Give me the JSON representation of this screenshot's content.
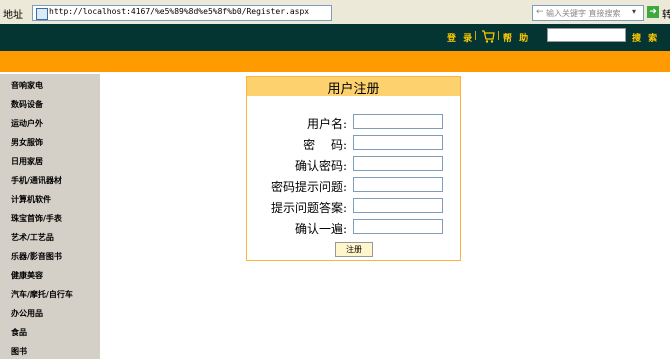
{
  "browser": {
    "address_label": "地址",
    "url": "http://localhost:4167/%e5%89%8d%e5%8f%b0/Register.aspx",
    "search_placeholder": "输入关键字 直接搜索",
    "go_label": "转"
  },
  "header": {
    "login_label": "登 录",
    "separator": "|",
    "help_label": "帮 助",
    "search_button_label": "搜 索",
    "search_value": ""
  },
  "sidebar": {
    "items": [
      {
        "label": "音响家电"
      },
      {
        "label": "数码设备"
      },
      {
        "label": "运动户外"
      },
      {
        "label": "男女服饰"
      },
      {
        "label": "日用家居"
      },
      {
        "label": "手机/通讯器材"
      },
      {
        "label": "计算机软件"
      },
      {
        "label": "珠宝首饰/手表"
      },
      {
        "label": "艺术/工艺品"
      },
      {
        "label": "乐器/影音图书"
      },
      {
        "label": "健康美容"
      },
      {
        "label": "汽车/摩托/自行车"
      },
      {
        "label": "办公用品"
      },
      {
        "label": "食品"
      },
      {
        "label": "图书"
      }
    ]
  },
  "register": {
    "title": "用户注册",
    "fields": [
      {
        "label": "用户名:",
        "value": ""
      },
      {
        "label": "密　 码:",
        "value": ""
      },
      {
        "label": "确认密码:",
        "value": ""
      },
      {
        "label": "密码提示问题:",
        "value": ""
      },
      {
        "label": "提示问题答案:",
        "value": ""
      },
      {
        "label": "确认一遍:",
        "value": ""
      }
    ],
    "submit_label": "注册"
  },
  "colors": {
    "header_bg": "#053532",
    "accent_orange": "#ff9a00",
    "link_yellow": "#ffcc00",
    "sidebar_bg": "#d4d0c8",
    "panel_title_bg": "#fcd16e"
  }
}
